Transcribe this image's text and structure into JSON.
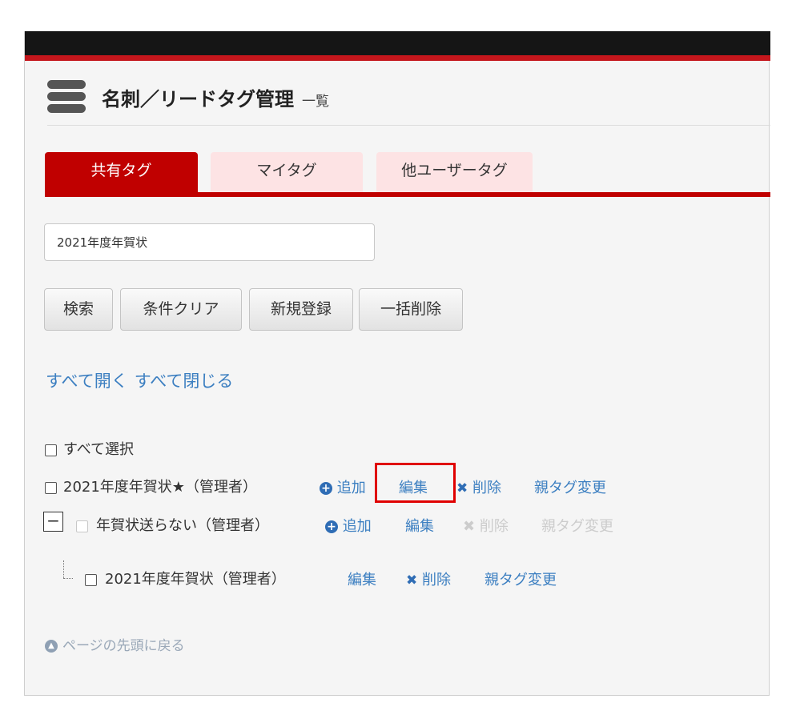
{
  "header": {
    "title": "名刺／リードタグ管理",
    "subtitle": "一覧"
  },
  "tabs": [
    {
      "label": "共有タグ",
      "active": true
    },
    {
      "label": "マイタグ",
      "active": false
    },
    {
      "label": "他ユーザータグ",
      "active": false
    }
  ],
  "search": {
    "value": "2021年度年賀状"
  },
  "buttons": {
    "search": "検索",
    "clear": "条件クリア",
    "new": "新規登録",
    "bulk_delete": "一括削除"
  },
  "expand": {
    "open_all": "すべて開く",
    "close_all": "すべて閉じる"
  },
  "select_all_label": "すべて選択",
  "collapse_symbol": "−",
  "tags": [
    {
      "name": "2021年度年賀状★",
      "owner": "（管理者）",
      "add": "追加",
      "edit": "編集",
      "delete": "削除",
      "change_parent": "親タグ変更"
    },
    {
      "name": "年賀状送らない",
      "owner": "（管理者）",
      "add": "追加",
      "edit": "編集",
      "delete": "削除",
      "change_parent": "親タグ変更"
    },
    {
      "name": "2021年度年賀状",
      "owner": "（管理者）",
      "edit": "編集",
      "delete": "削除",
      "change_parent": "親タグ変更"
    }
  ],
  "footer": {
    "back_to_top": "ページの先頭に戻る"
  },
  "colors": {
    "brand_red": "#c00000",
    "tab_inactive": "#fde3e4",
    "link_blue": "#3c7fc1",
    "highlight": "#e00000"
  }
}
